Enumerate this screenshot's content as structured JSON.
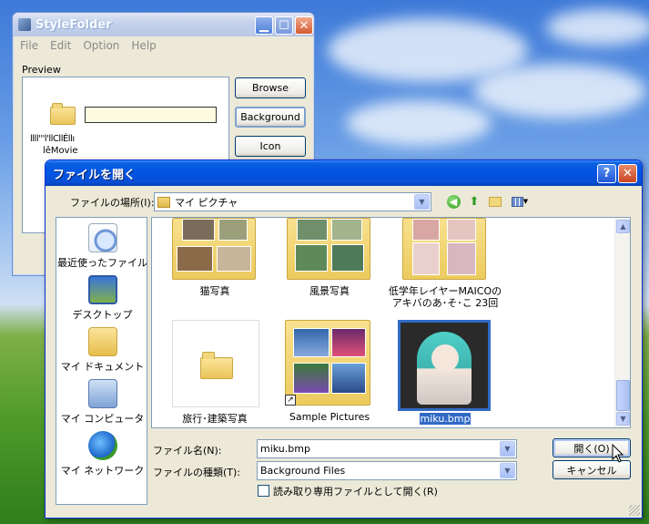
{
  "stylefolder": {
    "title": "StyleFolder",
    "menu": [
      "File",
      "Edit",
      "Option",
      "Help"
    ],
    "preview_label": "Preview",
    "preview_caption_1": "llll'''l'llCllÉllı",
    "preview_caption_2": "lêMovie",
    "buttons": {
      "browse": "Browse",
      "background": "Background",
      "icon": "Icon"
    }
  },
  "dialog": {
    "title": "ファイルを開く",
    "look_in_label": "ファイルの場所(I):",
    "look_in_value": "マイ ピクチャ",
    "places": [
      "最近使ったファイル",
      "デスクトップ",
      "マイ ドキュメント",
      "マイ コンピュータ",
      "マイ ネットワーク"
    ],
    "files": [
      {
        "label": "猫写真",
        "kind": "folder"
      },
      {
        "label": "風景写真",
        "kind": "folder"
      },
      {
        "label": "低学年レイヤーMAICOの",
        "label2": "アキバのあ･そ･こ 23回",
        "kind": "folder"
      },
      {
        "label": "旅行･建築写真",
        "kind": "folder"
      },
      {
        "label": "Sample Pictures",
        "kind": "shortcut-folder"
      },
      {
        "label": "miku.bmp",
        "kind": "image",
        "selected": true
      }
    ],
    "filename_label": "ファイル名(N):",
    "filename_value": "miku.bmp",
    "filetype_label": "ファイルの種類(T):",
    "filetype_value": "Background Files",
    "readonly_label": "読み取り専用ファイルとして開く(R)",
    "open_button": "開く(O)",
    "cancel_button": "キャンセル"
  },
  "colors": {
    "xp_blue": "#0054e3",
    "selection": "#316ac5",
    "dialog_bg": "#ece9d8"
  }
}
